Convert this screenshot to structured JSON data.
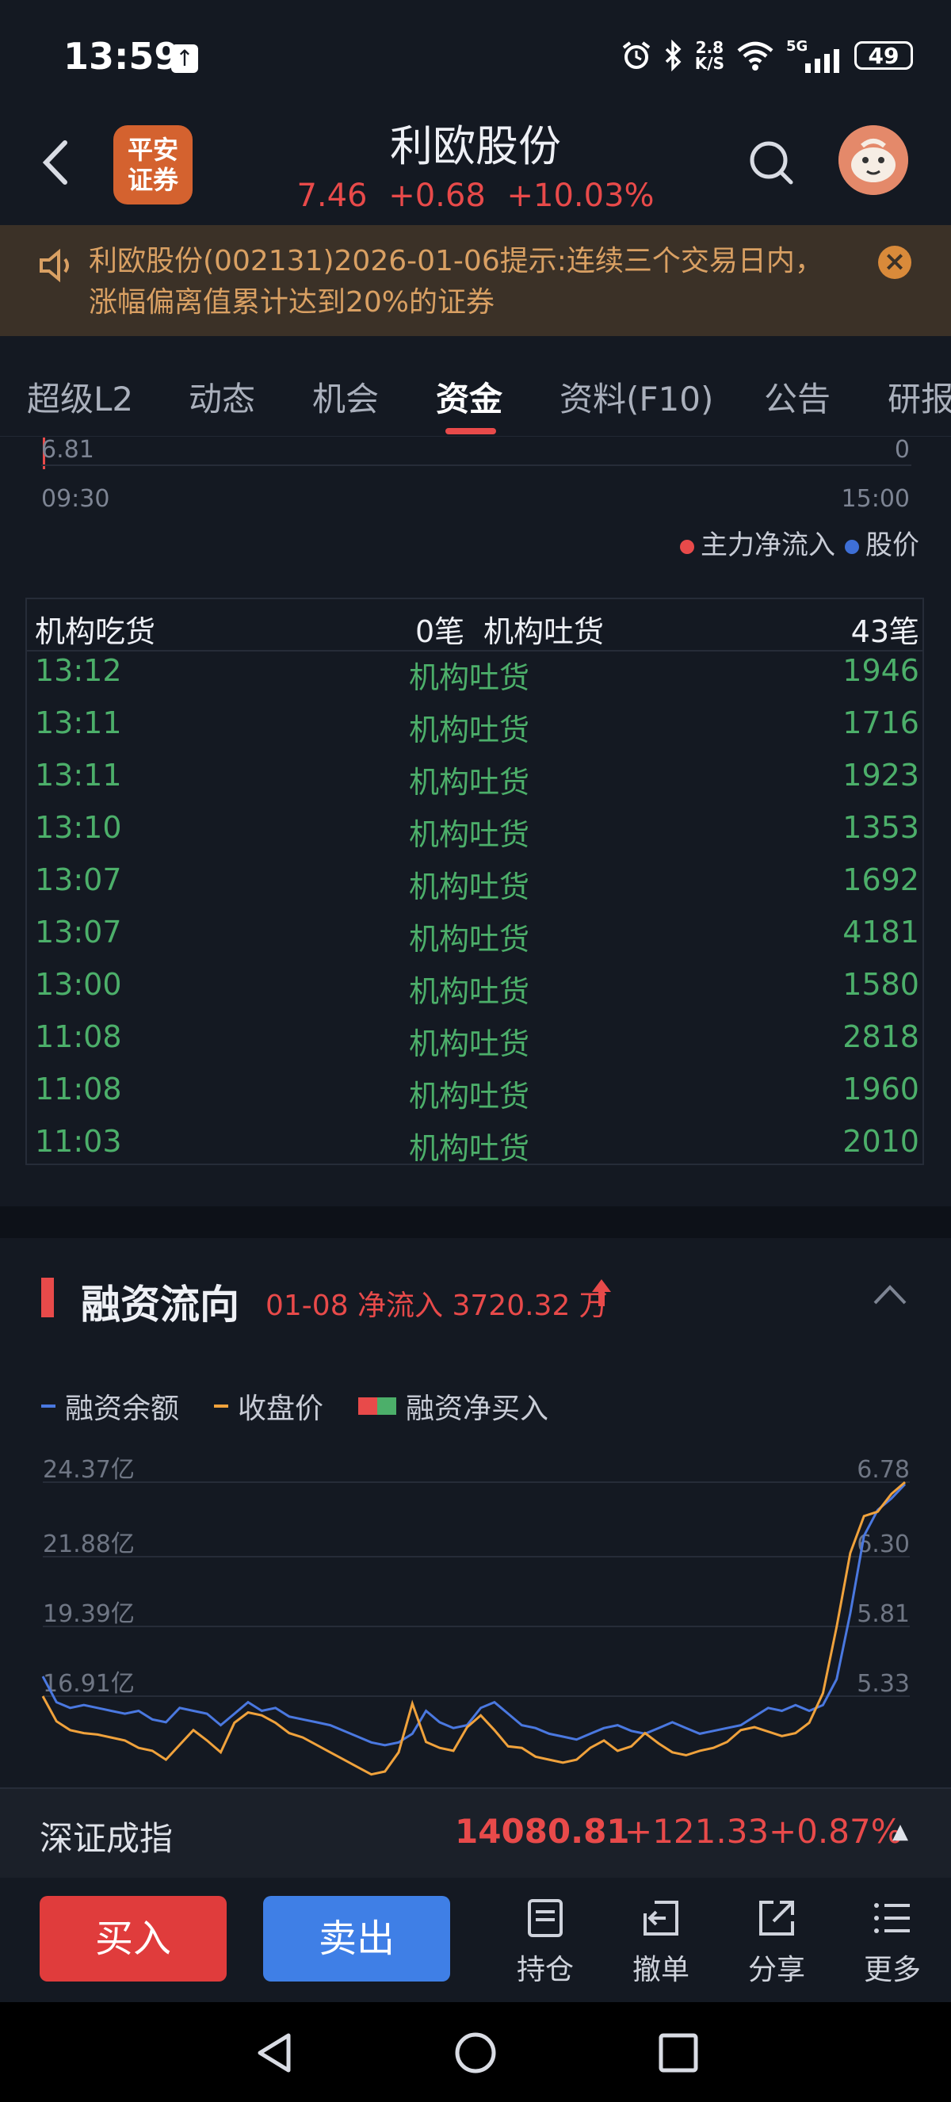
{
  "status_bar": {
    "time": "13:59",
    "net_speed_top": "2.8",
    "net_speed_bottom": "K/S",
    "signal_label": "5G",
    "battery": "49"
  },
  "header": {
    "broker_logo_line1": "平安",
    "broker_logo_line2": "证券",
    "stock_name": "利欧股份",
    "price": "7.46",
    "change": "+0.68",
    "change_pct": "+10.03%"
  },
  "notice": {
    "text": "利欧股份(002131)2026-01-06提示:连续三个交易日内，涨幅偏离值累计达到20%的证券"
  },
  "tabs": [
    {
      "label": "超级L2"
    },
    {
      "label": "动态"
    },
    {
      "label": "机会"
    },
    {
      "label": "资金"
    },
    {
      "label": "资料(F10)"
    },
    {
      "label": "公告"
    },
    {
      "label": "研报"
    }
  ],
  "flow_chart": {
    "y_min_label": "6.81",
    "y_min_right": "0",
    "x_start": "09:30",
    "x_end": "15:00",
    "legend": {
      "main_flow": "主力净流入",
      "price": "股价"
    },
    "colors": {
      "main_flow": "#e84a4a",
      "price": "#3e6fd6"
    }
  },
  "institution": {
    "buy_label": "机构吃货",
    "buy_count": "0笔",
    "sell_label": "机构吐货",
    "sell_count": "43笔",
    "rows": [
      {
        "time": "13:12",
        "type": "机构吐货",
        "volume": "1946"
      },
      {
        "time": "13:11",
        "type": "机构吐货",
        "volume": "1716"
      },
      {
        "time": "13:11",
        "type": "机构吐货",
        "volume": "1923"
      },
      {
        "time": "13:10",
        "type": "机构吐货",
        "volume": "1353"
      },
      {
        "time": "13:07",
        "type": "机构吐货",
        "volume": "1692"
      },
      {
        "time": "13:07",
        "type": "机构吐货",
        "volume": "4181"
      },
      {
        "time": "13:00",
        "type": "机构吐货",
        "volume": "1580"
      },
      {
        "time": "11:08",
        "type": "机构吐货",
        "volume": "2818"
      },
      {
        "time": "11:08",
        "type": "机构吐货",
        "volume": "1960"
      },
      {
        "time": "11:03",
        "type": "机构吐货",
        "volume": "2010"
      }
    ]
  },
  "margin": {
    "title": "融资流向",
    "subtitle": "01-08 净流入 3720.32 万",
    "legend": {
      "balance": "融资余额",
      "close": "收盘价",
      "net_buy": "融资净买入"
    },
    "colors": {
      "balance": "#4a78e0",
      "close": "#f0a23c",
      "up": "#e84a4a",
      "down": "#4caf6a"
    }
  },
  "chart_data": {
    "type": "line",
    "y_left_ticks": [
      "24.37亿",
      "21.88亿",
      "19.39亿",
      "16.91亿"
    ],
    "y_right_ticks": [
      "6.78",
      "6.30",
      "5.81",
      "5.33"
    ],
    "ylim_left_yi": [
      16.91,
      24.37
    ],
    "ylim_right": [
      5.33,
      6.78
    ],
    "series": [
      {
        "name": "融资余额",
        "values": [
          17.6,
          16.7,
          16.5,
          16.6,
          16.5,
          16.4,
          16.3,
          16.4,
          16.1,
          16.0,
          16.5,
          16.4,
          16.3,
          15.9,
          16.3,
          16.7,
          16.4,
          16.5,
          16.2,
          16.1,
          16.0,
          15.9,
          15.7,
          15.5,
          15.3,
          15.2,
          15.3,
          15.6,
          16.4,
          16.0,
          15.8,
          15.9,
          16.5,
          16.7,
          16.3,
          15.9,
          15.8,
          15.6,
          15.5,
          15.4,
          15.6,
          15.8,
          15.9,
          15.7,
          15.6,
          15.8,
          16.0,
          15.8,
          15.6,
          15.7,
          15.8,
          15.9,
          16.2,
          16.5,
          16.4,
          16.6,
          16.4,
          16.6,
          17.5,
          19.8,
          22.5,
          23.4,
          23.8,
          24.3
        ]
      },
      {
        "name": "收盘价",
        "values": [
          5.33,
          5.16,
          5.1,
          5.08,
          5.07,
          5.05,
          5.03,
          4.98,
          4.96,
          4.9,
          5.0,
          5.1,
          5.03,
          4.95,
          5.15,
          5.22,
          5.2,
          5.15,
          5.08,
          5.05,
          5.0,
          4.95,
          4.9,
          4.85,
          4.8,
          4.82,
          4.95,
          5.28,
          5.02,
          4.98,
          4.96,
          5.12,
          5.2,
          5.1,
          4.99,
          4.98,
          4.92,
          4.9,
          4.88,
          4.9,
          4.98,
          5.03,
          4.96,
          4.99,
          5.08,
          5.01,
          4.95,
          4.93,
          4.96,
          4.98,
          5.02,
          5.1,
          5.12,
          5.09,
          5.06,
          5.08,
          5.15,
          5.35,
          5.8,
          6.3,
          6.55,
          6.58,
          6.7,
          6.78
        ]
      }
    ]
  },
  "ticker": {
    "name": "深证成指",
    "value": "14080.81",
    "change": "+121.33",
    "pct": "+0.87%"
  },
  "actions": {
    "buy": "买入",
    "sell": "卖出",
    "items": [
      {
        "label": "持仓"
      },
      {
        "label": "撤单"
      },
      {
        "label": "分享"
      },
      {
        "label": "更多"
      }
    ]
  }
}
